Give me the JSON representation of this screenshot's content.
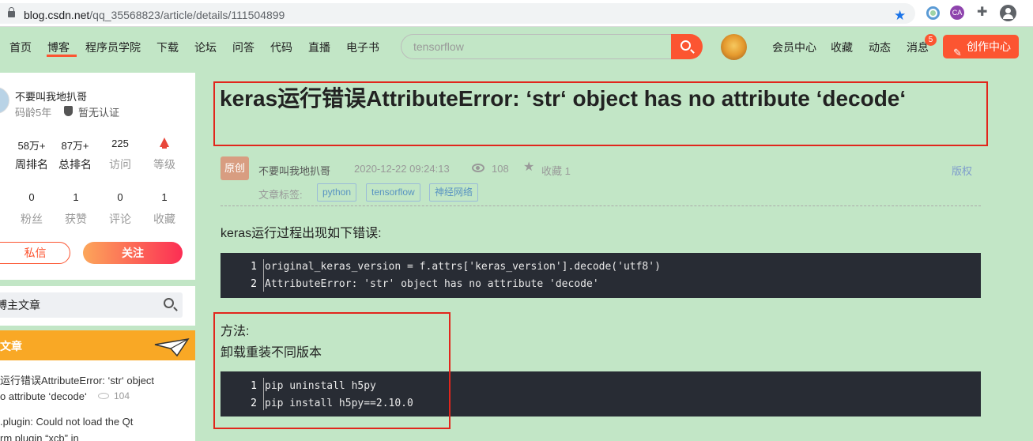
{
  "browser": {
    "url_domain": "blog.csdn.net",
    "url_path": "/qq_35568823/article/details/111504899",
    "ext_ca_label": "CA"
  },
  "nav": {
    "items": [
      "首页",
      "博客",
      "程序员学院",
      "下载",
      "论坛",
      "问答",
      "代码",
      "直播",
      "电子书"
    ],
    "active": "博客",
    "search_value": "tensorflow",
    "right_items": [
      "会员中心",
      "收藏",
      "动态",
      "消息"
    ],
    "message_count": "5",
    "create_label": "创作中心"
  },
  "profile": {
    "name": "不要叫我地扒哥",
    "age": "码龄5年",
    "cert": "暂无认证",
    "stats_row1": [
      {
        "value": "58万+",
        "label": "周排名"
      },
      {
        "value": "87万+",
        "label": "总排名"
      },
      {
        "value": "225",
        "label": "访问"
      },
      {
        "value": "",
        "label": "等级"
      }
    ],
    "stats_row2": [
      {
        "value": "0",
        "label": "粉丝"
      },
      {
        "value": "1",
        "label": "获赞"
      },
      {
        "value": "0",
        "label": "评论"
      },
      {
        "value": "1",
        "label": "收藏"
      }
    ],
    "message_label": "私信",
    "follow_label": "关注"
  },
  "sidebar": {
    "search_placeholder": "博主文章",
    "hot_title": "文章",
    "hot_lines": [
      "运行错误AttributeError: ‘str‘ object",
      "o attribute ‘decode‘",
      ".plugin: Could not load the Qt",
      "rm plugin “xcb” in"
    ],
    "hot_views": "104"
  },
  "article": {
    "title": "keras运行错误AttributeError: ‘str‘ object has no attribute ‘decode‘",
    "original_tag": "原创",
    "author": "不要叫我地扒哥",
    "date": "2020-12-22 09:24:13",
    "views": "108",
    "favorites": "收藏 1",
    "copyright": "版权",
    "tags_label": "文章标签:",
    "tags": [
      "python",
      "tensorflow",
      "神经网络"
    ],
    "intro": "keras运行过程出现如下错误:",
    "code1": [
      "original_keras_version = f.attrs['keras_version'].decode('utf8')",
      "AttributeError: 'str' object has no attribute 'decode'"
    ],
    "method_label": "方法:",
    "method_text": "卸载重装不同版本",
    "code2": [
      "pip uninstall h5py",
      "pip install h5py==2.10.0"
    ],
    "line_numbers": [
      "1",
      "2"
    ]
  },
  "colors": {
    "accent": "#fc5531",
    "background": "#c2e6c6",
    "highlight_box": "#e1261c",
    "code_bg": "#282c34"
  }
}
